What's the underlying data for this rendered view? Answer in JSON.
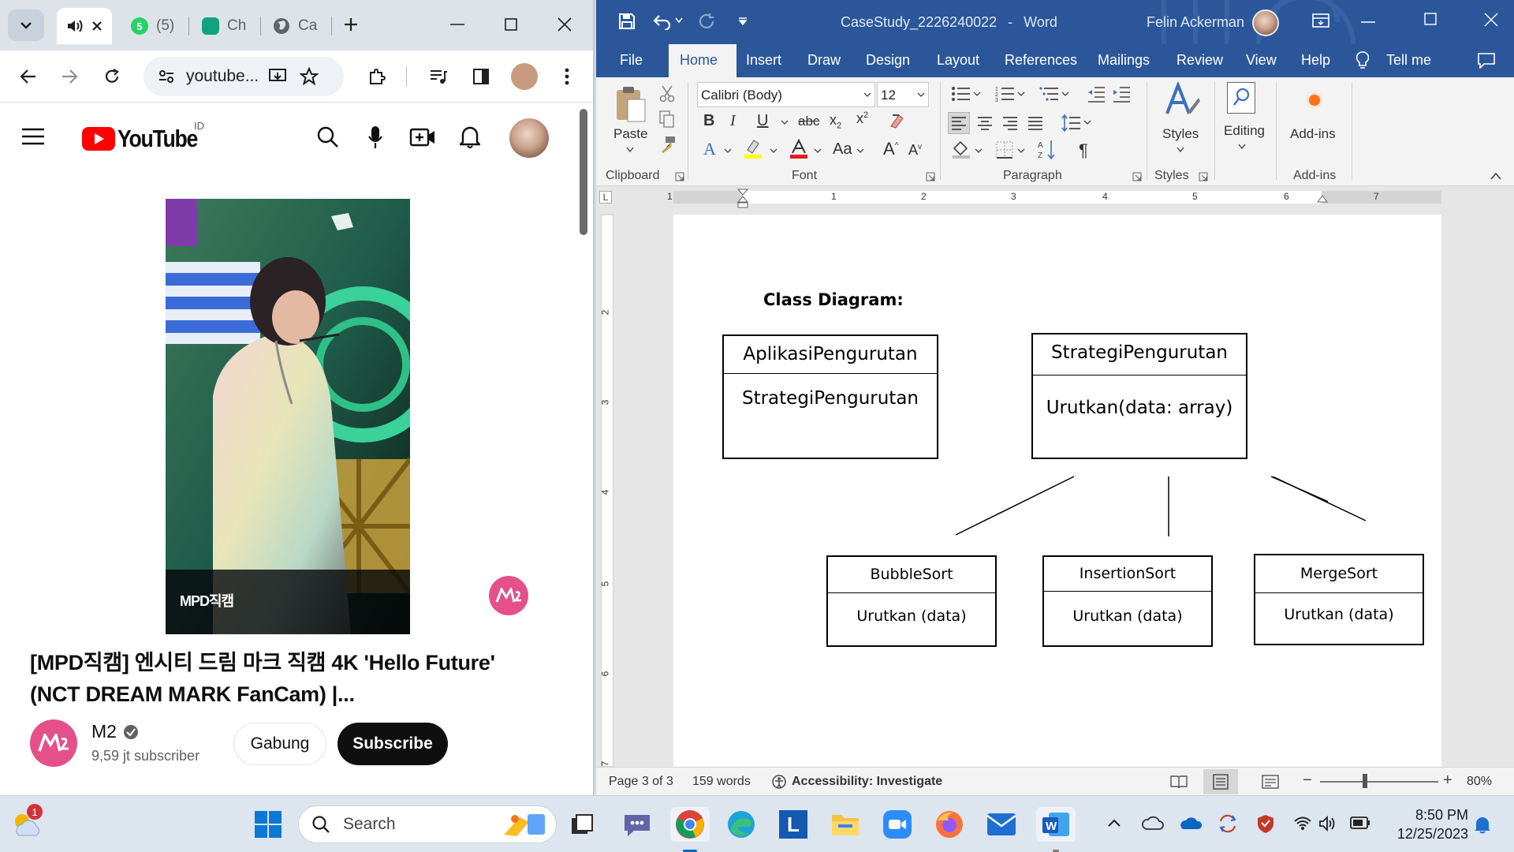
{
  "chrome": {
    "tabs": [
      {
        "label": "",
        "icon": "speaker-icon"
      },
      {
        "label": "(5)",
        "icon": "whatsapp-icon"
      },
      {
        "label": "Ch",
        "icon": "chatgpt-icon"
      },
      {
        "label": "Ca",
        "icon": "globe-icon"
      }
    ],
    "url": "youtube...",
    "youtube": {
      "logo_text": "YouTube",
      "region": "ID",
      "video_title": "[MPD직캠] 엔시티 드림 마크 직캠 4K 'Hello Future' (NCT DREAM MARK FanCam) |...",
      "channel_name": "M2",
      "subscribers": "9,59 jt subscriber",
      "join_label": "Gabung",
      "subscribe_label": "Subscribe",
      "video_watermark": "MPD직캠"
    }
  },
  "word": {
    "doc_title": "CaseStudy_2226240022",
    "app_name": "Word",
    "user_name": "Felin Ackerman",
    "menu": [
      "File",
      "Home",
      "Insert",
      "Draw",
      "Design",
      "Layout",
      "References",
      "Mailings",
      "Review",
      "View",
      "Help",
      "Tell me"
    ],
    "active_tab": "Home",
    "ribbon": {
      "paste": "Paste",
      "font_name": "Calibri (Body)",
      "font_size": "12",
      "styles": "Styles",
      "editing": "Editing",
      "addins": "Add-ins",
      "groups": [
        "Clipboard",
        "Font",
        "Paragraph",
        "Styles",
        "Add-ins"
      ]
    },
    "ruler_numbers": [
      "1",
      "1",
      "2",
      "3",
      "4",
      "5",
      "6",
      "7"
    ],
    "vruler_numbers": [
      "2",
      "3",
      "4",
      "5",
      "6",
      "7"
    ],
    "document": {
      "heading": "Class Diagram:",
      "classes": [
        {
          "name": "AplikasiPengurutan",
          "member": "StrategiPengurutan"
        },
        {
          "name": "StrategiPengurutan",
          "member": "Urutkan(data: array)"
        },
        {
          "name": "BubbleSort",
          "member": "Urutkan (data)"
        },
        {
          "name": "InsertionSort",
          "member": "Urutkan (data)"
        },
        {
          "name": "MergeSort",
          "member": "Urutkan (data)"
        }
      ]
    },
    "status": {
      "page": "Page 3 of 3",
      "words": "159 words",
      "accessibility": "Accessibility: Investigate",
      "zoom": "80%"
    }
  },
  "taskbar": {
    "search_placeholder": "Search",
    "time": "8:50 PM",
    "date": "12/25/2023",
    "weather_badge": "1"
  }
}
